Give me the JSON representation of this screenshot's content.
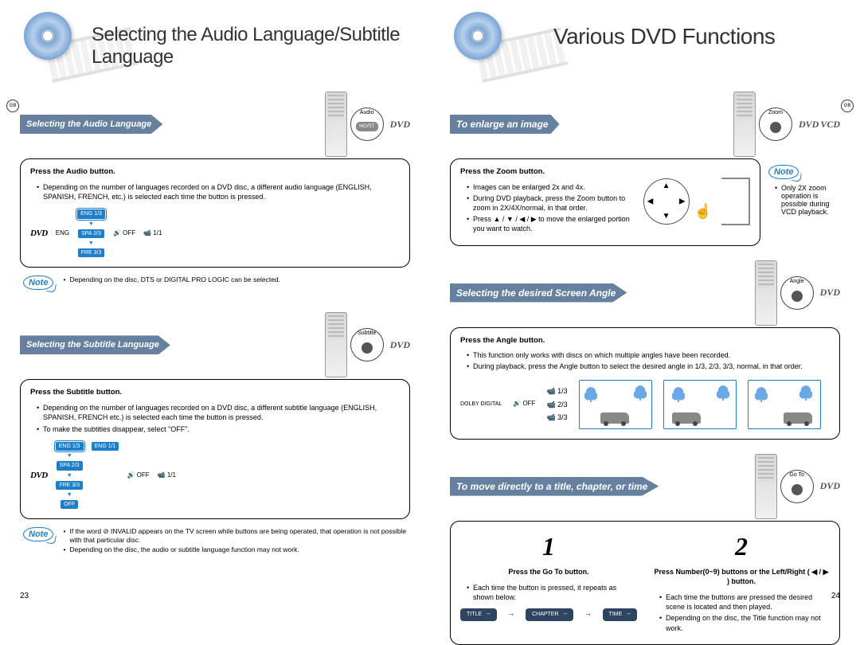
{
  "page_numbers": {
    "left": "23",
    "right": "24"
  },
  "gb_label": "GB",
  "titles": {
    "left": "Selecting the Audio Language/Subtitle Language",
    "right": "Various DVD Functions"
  },
  "badges": {
    "dvd": "DVD",
    "vcd": "VCD"
  },
  "left_sections": {
    "audio": {
      "tab": "Selecting the Audio Language",
      "callout_label": "Audio",
      "callout_btn": "MO/ST",
      "main": "Press the Audio button.",
      "bullet": "Depending on the number of languages recorded on a DVD disc, a different audio language (ENGLISH, SPANISH, FRENCH, etc.) is selected each time the button is pressed.",
      "display_eng": "ENG",
      "chips": [
        "ENG 1/3",
        "SPA 2/3",
        "FRE 3/3"
      ],
      "off": "OFF",
      "one_one": "1/1",
      "note": "Depending on the disc, DTS or DIGITAL PRO LOGIC can be selected."
    },
    "subtitle": {
      "tab": "Selecting the Subtitle Language",
      "callout_label": "Subtitle",
      "main": "Press the Subtitle button.",
      "bullet1": "Depending on the number of languages recorded on a DVD disc, a different subtitle language (ENGLISH, SPANISH, FRENCH etc.) is selected each time the button is pressed.",
      "bullet2": "To make the subtitles disappear, select \"OFF\".",
      "chips": [
        "ENG 1/3",
        "SPA 2/3",
        "FRE 3/3",
        "OFF"
      ],
      "side_chip": "ENG 1/1",
      "off": "OFF",
      "one_one": "1/1",
      "note1": "If the word ⊘ INVALID appears on the TV screen while buttons are being operated, that operation is not possible with that particular disc.",
      "note2": "Depending on the disc, the audio or subtitle language function may not work."
    }
  },
  "right_sections": {
    "zoom": {
      "tab": "To enlarge an image",
      "callout_label": "Zoom",
      "main": "Press the Zoom button.",
      "b1": "Images can be enlarged 2x and 4x.",
      "b2": "During DVD playback, press the Zoom button to zoom in 2X/4X/normal, in that order.",
      "b3": "Press ▲ / ▼ / ◀ / ▶ to move the enlarged portion you want to watch.",
      "note": "Only 2X zoom operation is possible during VCD playback."
    },
    "angle": {
      "tab": "Selecting the desired Screen Angle",
      "callout_label": "Angle",
      "main": "Press the Angle button.",
      "b1": "This function only works with discs on which multiple angles have been recorded.",
      "b2": "During playback, press the Angle button to select the desired angle in 1/3, 2/3, 3/3, normal, in that order.",
      "off": "OFF",
      "angles": [
        "1/3",
        "2/3",
        "3/3"
      ],
      "dolby": "DOLBY DIGITAL"
    },
    "goto": {
      "tab": "To move directly to a title, chapter, or time",
      "callout_label": "Go To",
      "num1": "1",
      "num2": "2",
      "inst1": "Press the Go To button.",
      "inst2": "Press Number(0~9) buttons or the Left/Right ( ◀ / ▶ ) button.",
      "b_left": "Each time the button is pressed, it repeats as shown below.",
      "b_right1": "Each time the buttons are pressed the desired scene is located and then played.",
      "b_right2": "Depending on the disc, the Title function may not work.",
      "screens": [
        "TITLE",
        "CHAPTER",
        "TIME"
      ]
    }
  },
  "note_label": "Note"
}
